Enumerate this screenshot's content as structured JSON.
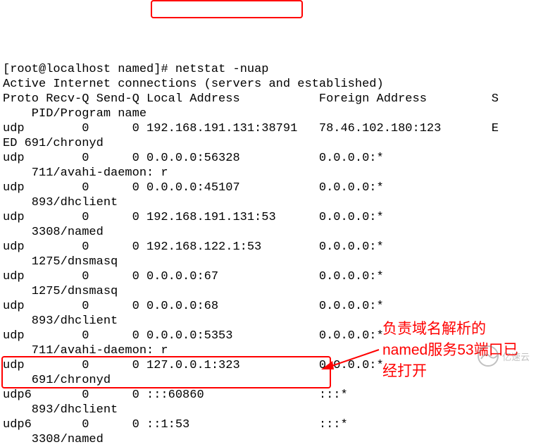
{
  "prompt": {
    "user": "root",
    "host": "localhost",
    "dir": "named",
    "symbol": "#",
    "command": "netstat -nuap"
  },
  "header": {
    "title": "Active Internet connections (servers and established)",
    "cols": "Proto Recv-Q Send-Q Local Address           Foreign Address         S",
    "sub": "    PID/Program name"
  },
  "rows": {
    "r0": "udp        0      0 192.168.191.131:38791   78.46.102.180:123       E",
    "r0b": "ED 691/chronyd",
    "r1": "udp        0      0 0.0.0.0:56328           0.0.0.0:*",
    "r1b": "    711/avahi-daemon: r",
    "r2": "udp        0      0 0.0.0.0:45107           0.0.0.0:*",
    "r2b": "    893/dhclient",
    "r3": "udp        0      0 192.168.191.131:53      0.0.0.0:*",
    "r3b": "    3308/named",
    "r4": "udp        0      0 192.168.122.1:53        0.0.0.0:*",
    "r4b": "    1275/dnsmasq",
    "r5": "udp        0      0 0.0.0.0:67              0.0.0.0:*",
    "r5b": "    1275/dnsmasq",
    "r6": "udp        0      0 0.0.0.0:68              0.0.0.0:*",
    "r6b": "    893/dhclient",
    "r7": "udp        0      0 0.0.0.0:5353            0.0.0.0:*",
    "r7b": "    711/avahi-daemon: r",
    "r8": "udp        0      0 127.0.0.1:323           0.0.0.0:*",
    "r8b": "    691/chronyd",
    "r9": "udp6       0      0 :::60860                :::*",
    "r9b": "    893/dhclient",
    "r10": "udp6       0      0 ::1:53                  :::*",
    "r10b": "    3308/named"
  },
  "annotation": {
    "text": "负责域名解析的named服务53端口已经打开"
  },
  "watermark": {
    "text": "亿速云"
  }
}
